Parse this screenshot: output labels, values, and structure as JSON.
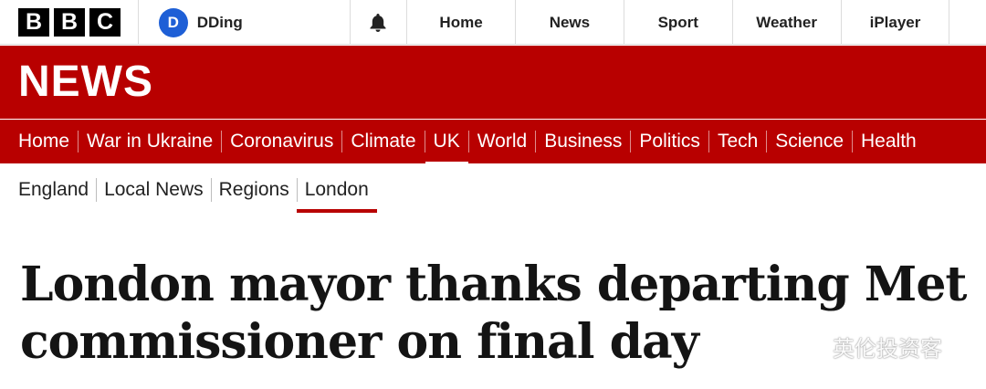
{
  "brand": {
    "letters": [
      "B",
      "B",
      "C"
    ]
  },
  "account": {
    "initial": "D",
    "name": "DDing"
  },
  "top_nav": {
    "notifications_icon": "bell-icon",
    "items": [
      "Home",
      "News",
      "Sport",
      "Weather",
      "iPlayer"
    ]
  },
  "masthead": {
    "title": "NEWS"
  },
  "primary_nav": {
    "items": [
      "Home",
      "War in Ukraine",
      "Coronavirus",
      "Climate",
      "UK",
      "World",
      "Business",
      "Politics",
      "Tech",
      "Science",
      "Health"
    ],
    "active": "UK"
  },
  "secondary_nav": {
    "items": [
      "England",
      "Local News",
      "Regions",
      "London"
    ],
    "active": "London"
  },
  "article": {
    "headline": "London mayor thanks departing Met commissioner on final day"
  },
  "watermark": {
    "text": "英伦投资客",
    "icon": "wechat-icon"
  },
  "colors": {
    "brand_red": "#b80000",
    "avatar_blue": "#1e5fd6"
  }
}
